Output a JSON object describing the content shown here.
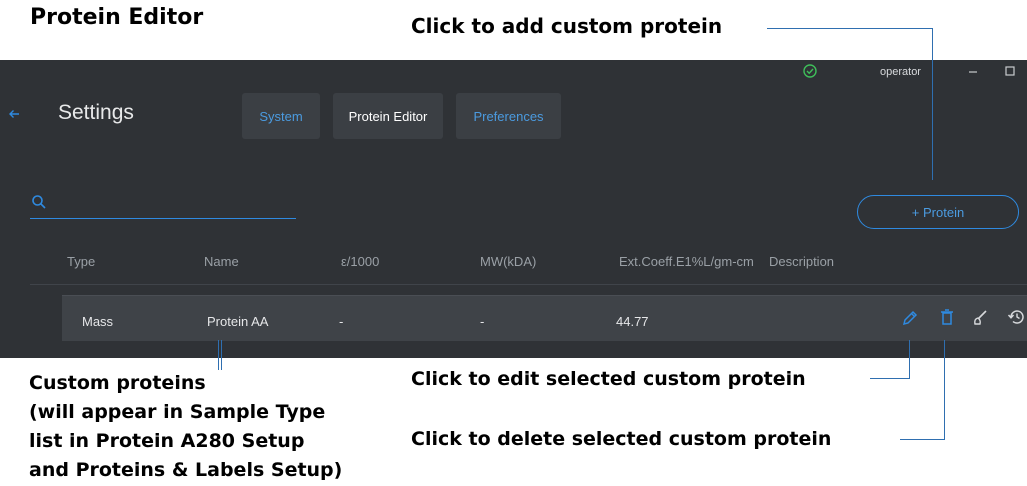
{
  "annotations": {
    "title": "Protein Editor",
    "add": "Click to add custom protein",
    "custom_lines": [
      "Custom proteins",
      "(will appear in Sample Type",
      "list in Protein A280 Setup",
      "and Proteins & Labels Setup)"
    ],
    "edit": "Click to edit selected custom protein",
    "delete": "Click to delete selected custom protein"
  },
  "titlebar": {
    "user": "operator"
  },
  "header": {
    "title": "Settings"
  },
  "tabs": [
    {
      "label": "System",
      "active": false
    },
    {
      "label": "Protein Editor",
      "active": true
    },
    {
      "label": "Preferences",
      "active": false
    }
  ],
  "search": {
    "placeholder": ""
  },
  "add_button": {
    "label": "+ Protein"
  },
  "table": {
    "columns": [
      "Type",
      "Name",
      "ε/1000",
      "MW(kDA)",
      "Ext.Coeff.E1%L/gm-cm",
      "Description"
    ],
    "rows": [
      {
        "type": "Mass",
        "name": "Protein AA",
        "epsilon": "-",
        "mw": "-",
        "ext_coeff": "44.77",
        "description": ""
      }
    ]
  },
  "colors": {
    "accent": "#2f8ae0",
    "panel": "#2f3236",
    "row_selected": "#3f4348",
    "status_ok": "#3fbf5a"
  }
}
